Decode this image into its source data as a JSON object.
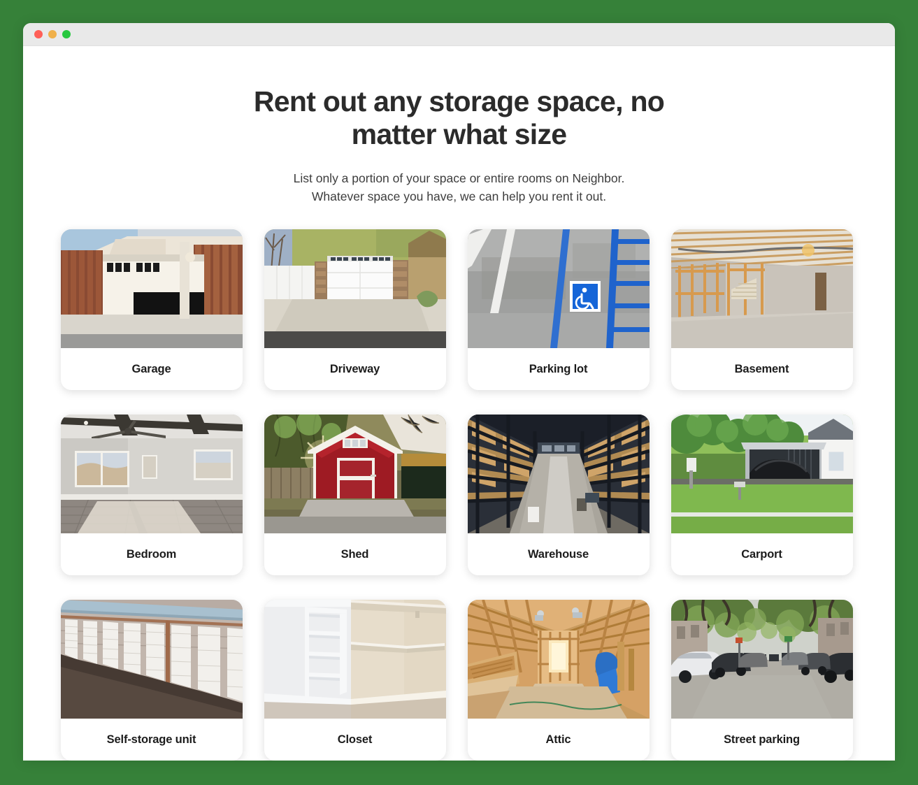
{
  "window": {
    "controls": [
      {
        "name": "close",
        "color": "#ff5f57"
      },
      {
        "name": "minimize",
        "color": "#f0b04a"
      },
      {
        "name": "zoom",
        "color": "#28c840"
      }
    ]
  },
  "hero": {
    "headline": "Rent out any storage space, no matter what size",
    "subtitle_line1": "List only a portion of your space or entire rooms on Neighbor.",
    "subtitle_line2": "Whatever space you have, we can help you rent it out."
  },
  "theme": {
    "page_background": "#368139",
    "card_background": "#ffffff",
    "label_color": "#1c1c1c",
    "headline_color": "#2b2b2b",
    "subtitle_color": "#3d3d3d",
    "accessibility_sign_blue": "#1565d8"
  },
  "space_types": [
    {
      "label": "Garage",
      "image": "garage-photo"
    },
    {
      "label": "Driveway",
      "image": "driveway-photo"
    },
    {
      "label": "Parking lot",
      "image": "parking-lot-photo"
    },
    {
      "label": "Basement",
      "image": "basement-photo"
    },
    {
      "label": "Bedroom",
      "image": "bedroom-photo"
    },
    {
      "label": "Shed",
      "image": "shed-photo"
    },
    {
      "label": "Warehouse",
      "image": "warehouse-photo"
    },
    {
      "label": "Carport",
      "image": "carport-photo"
    },
    {
      "label": "Self-storage unit",
      "image": "self-storage-unit-photo"
    },
    {
      "label": "Closet",
      "image": "closet-photo"
    },
    {
      "label": "Attic",
      "image": "attic-photo"
    },
    {
      "label": "Street parking",
      "image": "street-parking-photo"
    }
  ]
}
